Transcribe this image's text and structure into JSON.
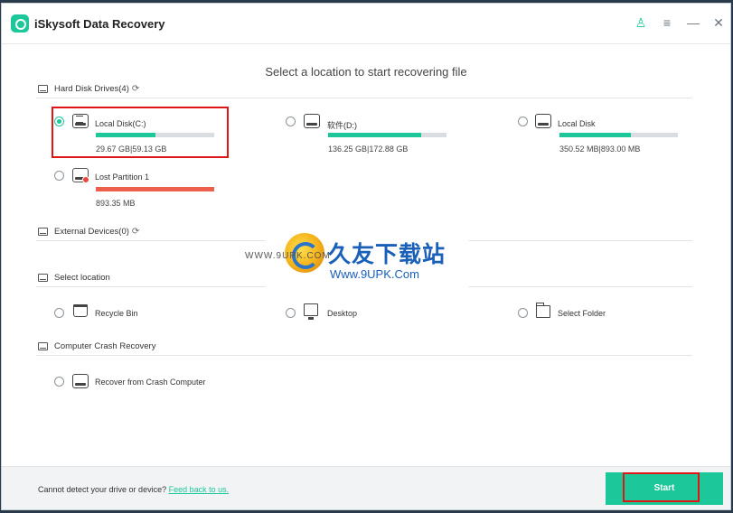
{
  "app": {
    "title": "iSkysoft Data Recovery"
  },
  "titlebar": {
    "user_icon": "user-icon",
    "menu_icon": "menu-icon",
    "minimize_icon": "minimize-icon",
    "close_icon": "close-icon"
  },
  "heading": "Select a location to start recovering file",
  "sections": {
    "hard_disk": {
      "label": "Hard Disk Drives(4)"
    },
    "external": {
      "label": "External Devices(0)"
    },
    "select_location": {
      "label": "Select location"
    },
    "crash": {
      "label": "Computer Crash Recovery"
    }
  },
  "drives": [
    {
      "label": "Local Disk(C:)",
      "size": "29.67 GB|59.13 GB",
      "fill": 0.5,
      "selected": true
    },
    {
      "label": "软件(D:)",
      "size": "136.25 GB|172.88 GB",
      "fill": 0.79,
      "selected": false
    },
    {
      "label": "Local Disk",
      "size": "350.52 MB|893.00 MB",
      "fill": 0.6,
      "selected": false
    },
    {
      "label": "Lost Partition 1",
      "size": "893.35 MB",
      "fill": 1.0,
      "selected": false
    }
  ],
  "locations": [
    {
      "label": "Recycle Bin"
    },
    {
      "label": "Desktop"
    },
    {
      "label": "Select Folder"
    }
  ],
  "crash_item": {
    "label": "Recover from Crash Computer"
  },
  "footer": {
    "text": "Cannot detect your drive or device?",
    "link": "Feed back to us."
  },
  "start_label": "Start",
  "watermark": {
    "cn": "久友下载站",
    "url": "Www.9UPK.Com",
    "small": "WWW.9UPK.COM"
  },
  "colors": {
    "accent": "#1cc79a",
    "lost": "#ee5e4d",
    "highlight": "#e01515"
  }
}
